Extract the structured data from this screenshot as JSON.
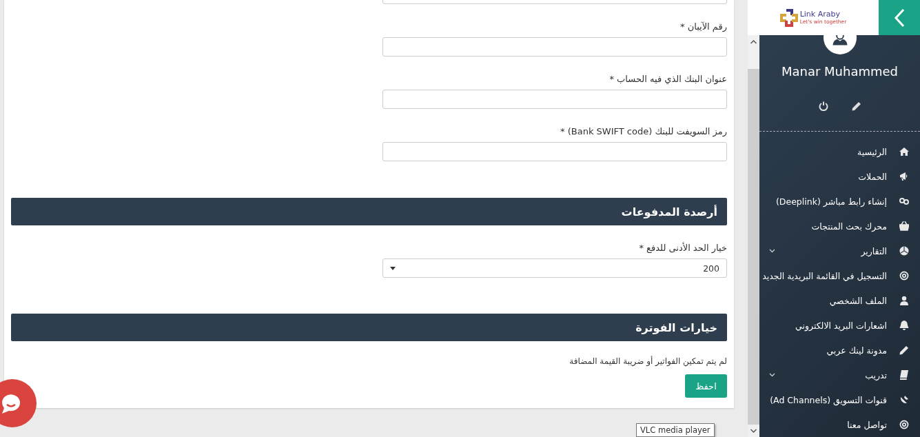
{
  "form": {
    "fields": [
      {
        "kind": "text"
      },
      {
        "kind": "text",
        "label": "رقم الآيبان *"
      },
      {
        "kind": "text",
        "label": "عنوان البنك الذي فيه الحساب *"
      },
      {
        "kind": "text",
        "label": "رمز السويفت للبنك (Bank SWIFT code) *"
      }
    ],
    "sections": [
      {
        "title": "أرصدة المدفوعات",
        "fields": [
          {
            "kind": "select",
            "label": "خيار الحد الأدنى للدفع *",
            "value": "200"
          }
        ]
      },
      {
        "title": "خيارات الفوترة",
        "note": "لم يتم تمكين الفواتير أو ضريبة القيمة المضافة",
        "button": "احفظ"
      }
    ]
  },
  "sidebar": {
    "logo": {
      "name": "Link Araby",
      "tagline": "Let's win together"
    },
    "user": {
      "name": "Manar Muhammed"
    },
    "items": [
      {
        "label": "الرئيسية",
        "kind": "link"
      },
      {
        "label": "الحملات",
        "kind": "link"
      },
      {
        "label": "إنشاء رابط مباشر (Deeplink)",
        "kind": "link"
      },
      {
        "label": "محرك بحث المنتجات",
        "kind": "link"
      },
      {
        "label": "التقارير",
        "kind": "submenu"
      },
      {
        "label": "التسجيل في القائمة البريدية الجديد",
        "kind": "link"
      },
      {
        "label": "الملف الشخصي",
        "kind": "link"
      },
      {
        "label": "اشعارات البريد الالكتروني",
        "kind": "link"
      },
      {
        "label": "مدونة لينك عربي",
        "kind": "link"
      },
      {
        "label": "تدريب",
        "kind": "submenu"
      },
      {
        "label": "قنوات التسويق (Ad Channels)",
        "kind": "link"
      },
      {
        "label": "تواصل معنا",
        "kind": "link"
      }
    ]
  },
  "tooltip": "VLC media player"
}
